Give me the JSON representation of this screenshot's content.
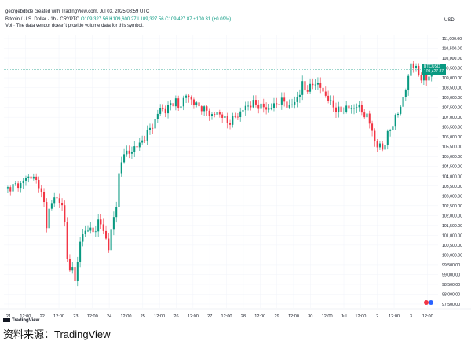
{
  "header": {
    "credit": "georgebdbde created with TradingView.com, Jul 03, 2025 08:59 UTC",
    "symbol_line": "Bitcoin / U.S. Dollar · 1h · CRYPTO",
    "ohlc": "O109,327.56 H109,600.27 L109,327.56 C109,427.87 +100.31 (+0.09%)",
    "vol_note": "Vol · The data vendor doesn't provide volume data for this symbol."
  },
  "price_tag": {
    "symbol": "BTCUSD",
    "price": "109,427.87",
    "countdown": "00:59"
  },
  "branding": {
    "tv_logo_text": "TradingView",
    "source": "资料来源：TradingView"
  },
  "colors": {
    "up": "#089981",
    "down": "#f23645",
    "grid": "#f0f3fa",
    "last_line": "#089981"
  },
  "chart_data": {
    "type": "candlestick",
    "currency_label": "USD",
    "ylim": [
      97300,
      111200
    ],
    "y_ticks": [
      "97,500.00",
      "98,000.00",
      "98,500.00",
      "99,000.00",
      "99,500.00",
      "100,000.00",
      "100,500.00",
      "101,000.00",
      "101,500.00",
      "102,000.00",
      "102,500.00",
      "103,000.00",
      "103,500.00",
      "104,000.00",
      "104,500.00",
      "105,000.00",
      "105,500.00",
      "106,000.00",
      "106,500.00",
      "107,000.00",
      "107,500.00",
      "108,000.00",
      "108,500.00",
      "109,000.00",
      "109,500.00",
      "110,000.00",
      "110,500.00",
      "111,000.00"
    ],
    "x_ticks": [
      "21",
      "12:00",
      "22",
      "12:00",
      "23",
      "12:00",
      "24",
      "12:00",
      "25",
      "12:00",
      "26",
      "12:00",
      "27",
      "12:00",
      "28",
      "12:00",
      "29",
      "12:00",
      "30",
      "12:00",
      "Jul",
      "12:00",
      "2",
      "12:00",
      "3",
      "12:00"
    ],
    "last_price": 109427.87,
    "close_path": [
      [
        0,
        103300
      ],
      [
        3,
        103500
      ],
      [
        6,
        103600
      ],
      [
        8,
        103900
      ],
      [
        10,
        104000
      ],
      [
        13,
        103600
      ],
      [
        15,
        102600
      ],
      [
        16,
        101500
      ],
      [
        17,
        102300
      ],
      [
        19,
        102900
      ],
      [
        21,
        102800
      ],
      [
        22,
        102400
      ],
      [
        23,
        101600
      ],
      [
        24,
        100000
      ],
      [
        25,
        99100
      ],
      [
        26,
        99300
      ],
      [
        27,
        98800
      ],
      [
        28,
        99600
      ],
      [
        29,
        100700
      ],
      [
        30,
        101000
      ],
      [
        32,
        101400
      ],
      [
        34,
        101100
      ],
      [
        36,
        101700
      ],
      [
        38,
        101300
      ],
      [
        39,
        100800
      ],
      [
        40,
        100300
      ],
      [
        41,
        101200
      ],
      [
        43,
        102600
      ],
      [
        44,
        104000
      ],
      [
        46,
        105300
      ],
      [
        48,
        105100
      ],
      [
        50,
        105500
      ],
      [
        52,
        105600
      ],
      [
        54,
        106000
      ],
      [
        56,
        106400
      ],
      [
        58,
        106800
      ],
      [
        60,
        107500
      ],
      [
        62,
        107300
      ],
      [
        64,
        107700
      ],
      [
        66,
        107800
      ],
      [
        67,
        107400
      ],
      [
        68,
        107700
      ],
      [
        70,
        108100
      ],
      [
        72,
        107900
      ],
      [
        74,
        107600
      ],
      [
        76,
        107500
      ],
      [
        78,
        107300
      ],
      [
        80,
        107100
      ],
      [
        82,
        107200
      ],
      [
        84,
        107100
      ],
      [
        86,
        106700
      ],
      [
        88,
        106900
      ],
      [
        90,
        107100
      ],
      [
        92,
        107400
      ],
      [
        94,
        107600
      ],
      [
        96,
        107700
      ],
      [
        98,
        107600
      ],
      [
        100,
        107500
      ],
      [
        102,
        107400
      ],
      [
        104,
        107600
      ],
      [
        106,
        107800
      ],
      [
        108,
        107800
      ],
      [
        110,
        107500
      ],
      [
        112,
        107800
      ],
      [
        114,
        108200
      ],
      [
        115,
        108700
      ],
      [
        116,
        108400
      ],
      [
        118,
        108500
      ],
      [
        120,
        108800
      ],
      [
        122,
        108500
      ],
      [
        124,
        108100
      ],
      [
        126,
        107700
      ],
      [
        128,
        107400
      ],
      [
        130,
        107300
      ],
      [
        132,
        107500
      ],
      [
        134,
        107400
      ],
      [
        136,
        107600
      ],
      [
        138,
        107300
      ],
      [
        140,
        107000
      ],
      [
        142,
        106400
      ],
      [
        143,
        105700
      ],
      [
        144,
        105500
      ],
      [
        145,
        105600
      ],
      [
        146,
        105400
      ],
      [
        147,
        105700
      ],
      [
        148,
        106100
      ],
      [
        150,
        106700
      ],
      [
        152,
        107200
      ],
      [
        154,
        108000
      ],
      [
        155,
        108400
      ],
      [
        156,
        109000
      ],
      [
        157,
        109800
      ],
      [
        158,
        109600
      ],
      [
        159,
        109400
      ],
      [
        160,
        109200
      ],
      [
        161,
        109000
      ],
      [
        162,
        109200
      ],
      [
        163,
        108900
      ],
      [
        164,
        109100
      ],
      [
        165,
        109300
      ],
      [
        166,
        109428
      ]
    ]
  }
}
